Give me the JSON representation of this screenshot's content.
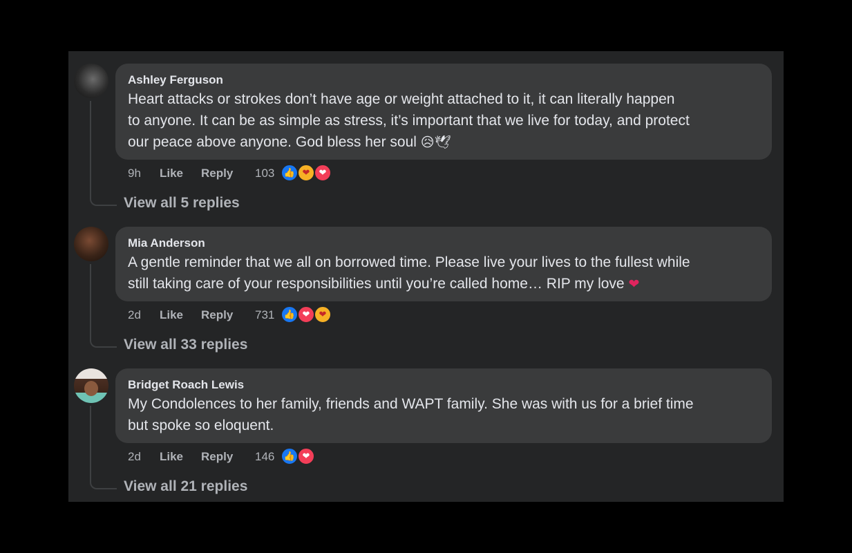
{
  "comments": [
    {
      "author": "Ashley Ferguson",
      "lines": [
        "Heart attacks or strokes don’t have age or weight attached to it, it can literally happen",
        "to anyone. It can be as simple as stress, it’s important that we live for today, and protect",
        "our peace above anyone. God bless her soul"
      ],
      "end_emojis": [
        "😥",
        "🕊"
      ],
      "time": "9h",
      "like_label": "Like",
      "reply_label": "Reply",
      "reaction_count": "103",
      "reactions": [
        "like-icon",
        "care-icon",
        "love-icon"
      ],
      "view_replies": "View all 5 replies"
    },
    {
      "author": "Mia Anderson",
      "lines": [
        "A gentle reminder that we all on borrowed time. Please live your lives to the fullest while",
        "still taking care of your responsibilities until you’re called home… RIP my love"
      ],
      "end_emojis": [
        "❤"
      ],
      "time": "2d",
      "like_label": "Like",
      "reply_label": "Reply",
      "reaction_count": "731",
      "reactions": [
        "like-icon",
        "love-icon",
        "care-icon"
      ],
      "view_replies": "View all 33 replies"
    },
    {
      "author": "Bridget Roach Lewis",
      "lines": [
        "My Condolences to her family, friends and WAPT family. She was with us for a brief time",
        "but spoke so eloquent."
      ],
      "end_emojis": [],
      "time": "2d",
      "like_label": "Like",
      "reply_label": "Reply",
      "reaction_count": "146",
      "reactions": [
        "like-icon",
        "love-icon"
      ],
      "view_replies": "View all 21 replies"
    }
  ],
  "colors": {
    "background": "#000000",
    "panel": "#242526",
    "bubble": "#3a3b3c",
    "primary_text": "#e4e6eb",
    "secondary_text": "#b0b3b8",
    "like_blue": "#1877f2",
    "love_red": "#f33e58",
    "care_yellow": "#f7b125"
  }
}
